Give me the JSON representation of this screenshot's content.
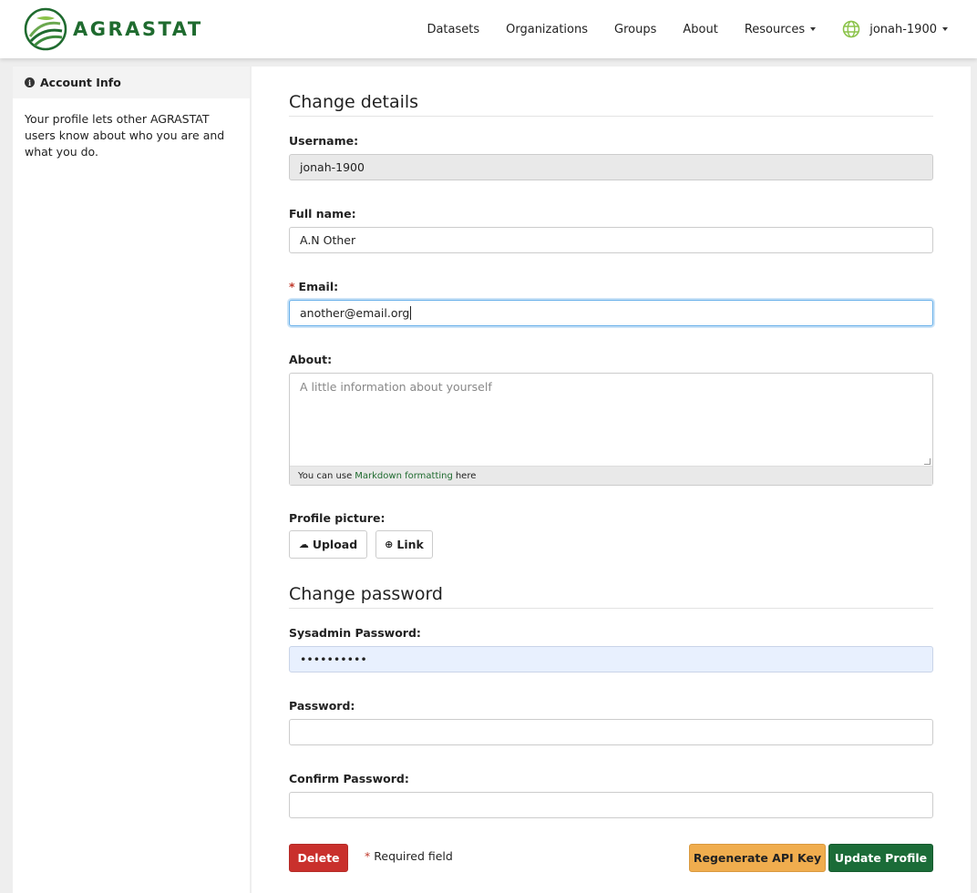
{
  "brand": {
    "name": "AGRASTAT"
  },
  "nav": {
    "datasets": "Datasets",
    "organizations": "Organizations",
    "groups": "Groups",
    "about": "About",
    "resources": "Resources",
    "user": "jonah-1900"
  },
  "sidebar": {
    "heading": "Account Info",
    "description": "Your profile lets other AGRASTAT users know about who you are and what you do."
  },
  "details": {
    "title": "Change details",
    "username_label": "Username:",
    "username_value": "jonah-1900",
    "fullname_label": "Full name:",
    "fullname_value": "A.N Other",
    "email_label": "Email:",
    "email_value": "another@email.org",
    "about_label": "About:",
    "about_placeholder": "A little information about yourself",
    "markdown_prefix": "You can use",
    "markdown_link": "Markdown formatting",
    "markdown_suffix": "here",
    "picture_label": "Profile picture:",
    "upload_button": "Upload",
    "link_button": "Link"
  },
  "password": {
    "title": "Change password",
    "sysadmin_label": "Sysadmin Password:",
    "sysadmin_value": "••••••••••",
    "password_label": "Password:",
    "confirm_label": "Confirm Password:"
  },
  "actions": {
    "delete": "Delete",
    "required_note": "Required field",
    "required_marker": "*",
    "regenerate": "Regenerate API Key",
    "update": "Update Profile"
  },
  "colors": {
    "brand_green": "#1f6b2f",
    "delete_red": "#c9302c",
    "regen_orange": "#f0ad4e",
    "update_green": "#1b6c38"
  }
}
